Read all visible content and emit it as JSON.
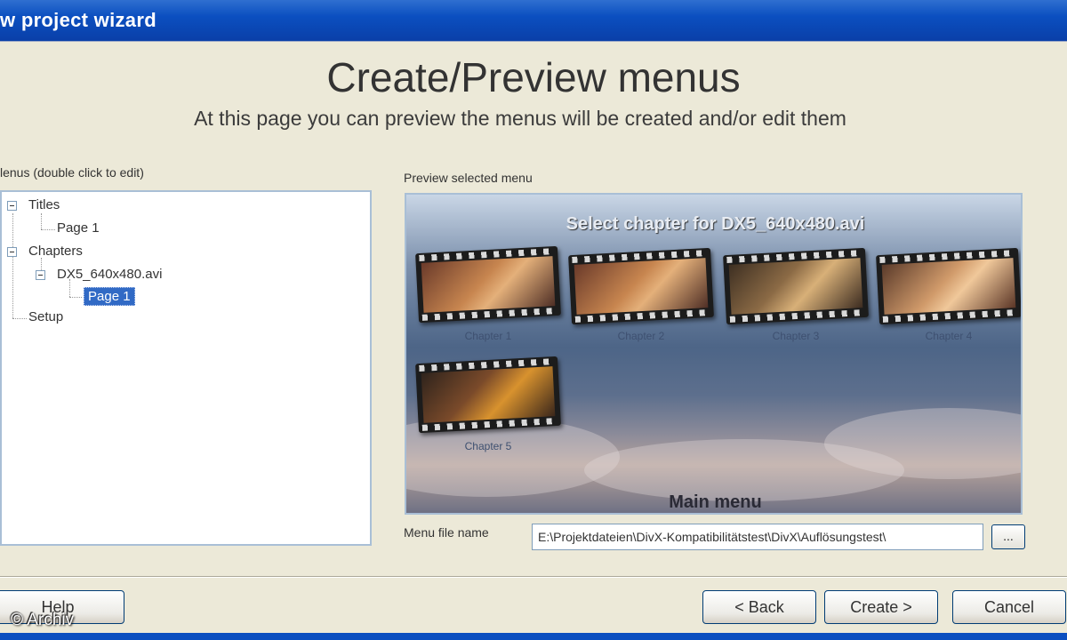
{
  "window": {
    "title": "w project wizard"
  },
  "header": {
    "title": "Create/Preview menus",
    "subtitle": "At this page you can preview the menus will be created and/or edit them"
  },
  "tree": {
    "label": "lenus (double click to edit)",
    "items": [
      {
        "label": "Titles",
        "level": 0,
        "expandable": true
      },
      {
        "label": "Page 1",
        "level": 1,
        "expandable": false
      },
      {
        "label": "Chapters",
        "level": 0,
        "expandable": true
      },
      {
        "label": "DX5_640x480.avi",
        "level": 1,
        "expandable": true
      },
      {
        "label": "Page 1",
        "level": 2,
        "expandable": false,
        "selected": true
      },
      {
        "label": "Setup",
        "level": 0,
        "expandable": false
      }
    ]
  },
  "preview": {
    "label": "Preview selected menu",
    "heading": "Select chapter for DX5_640x480.avi",
    "chapters": [
      "Chapter 1",
      "Chapter 2",
      "Chapter 3",
      "Chapter 4",
      "Chapter 5"
    ],
    "footer": "Main menu"
  },
  "menu_file": {
    "label": "Menu file name",
    "value": "E:\\Projektdateien\\DivX-Kompatibilitätstest\\DivX\\Auflösungstest\\",
    "browse_label": "..."
  },
  "buttons": {
    "help": "Help",
    "back": "< Back",
    "create": "Create >",
    "cancel": "Cancel"
  },
  "watermark": "© Archiv",
  "colors": {
    "titlebar": "#0b4fc0",
    "selection": "#316ac5",
    "dialog_bg": "#ece9d8"
  }
}
